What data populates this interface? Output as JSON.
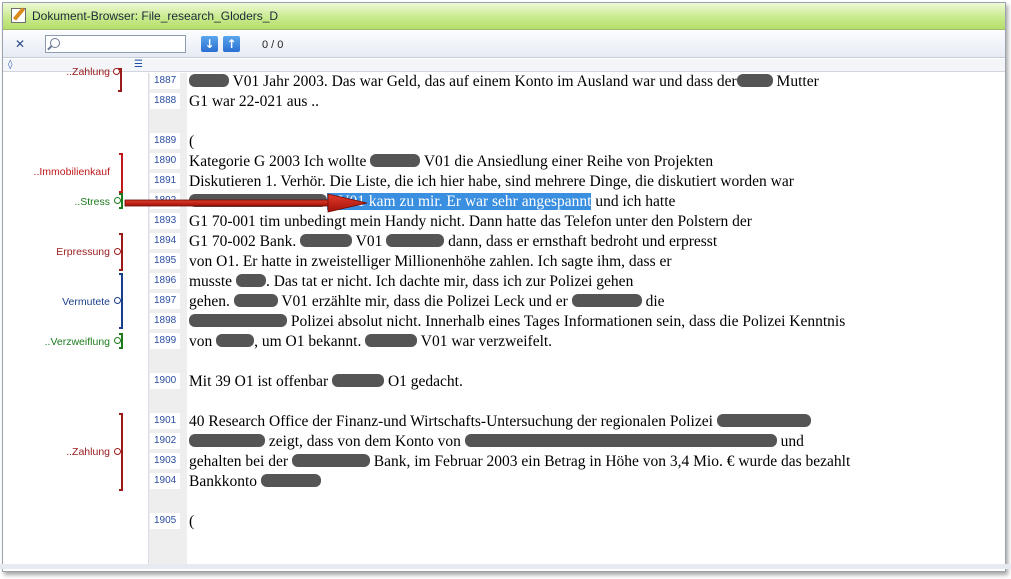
{
  "window": {
    "title": "Dokument-Browser: File_research_Gloders_D"
  },
  "toolbar": {
    "search_placeholder": "",
    "count": "0 / 0"
  },
  "codes": [
    {
      "label": "..Zahlung",
      "color": "#9b1b1b"
    },
    {
      "label": "..Immobilienkauf",
      "color": "#c01818"
    },
    {
      "label": "..Stress",
      "color": "#1d7a1d"
    },
    {
      "label": "Erpressung",
      "color": "#9b1b1b"
    },
    {
      "label": "Vermutete",
      "color": "#1a3f8a"
    },
    {
      "label": "..Verzweiflung",
      "color": "#1d7a1d"
    },
    {
      "label": "..Zahlung",
      "color": "#9b1b1b"
    }
  ],
  "lines": [
    {
      "num": "1887",
      "parts": [
        "",
        " V01 Jahr 2003. Das war Geld, das auf einem Konto im Ausland war und dass der",
        " Mutter"
      ]
    },
    {
      "num": "1888",
      "parts": [
        "G1 war 22-021 aus .."
      ]
    },
    {
      "num": "1889",
      "parts": [
        "("
      ]
    },
    {
      "num": "1890",
      "parts": [
        "Kategorie G 2003 Ich wollte ",
        " V01 die Ansiedlung einer Reihe von Projekten"
      ]
    },
    {
      "num": "1891",
      "parts": [
        "Diskutieren 1. Verhör. Die Liste, die ich hier habe, sind mehrere Dinge, die diskutiert worden war"
      ]
    },
    {
      "num": "1892",
      "parts": [
        "1 V01 kam zu mir. Er war sehr angespannt",
        " und ich hatte"
      ]
    },
    {
      "num": "1893",
      "parts": [
        "G1 70-001 tim unbedingt mein Handy nicht. Dann hatte das Telefon unter den Polstern der"
      ]
    },
    {
      "num": "1894",
      "parts": [
        "G1 70-002 Bank. ",
        " V01 ",
        " dann, dass er ernsthaft bedroht und erpresst"
      ]
    },
    {
      "num": "1895",
      "parts": [
        "von O1. Er hatte in zweistelliger Millionenhöhe zahlen. Ich sagte ihm, dass er"
      ]
    },
    {
      "num": "1896",
      "parts": [
        "musste ",
        ". Das tat er nicht. Ich dachte mir, dass ich zur Polizei gehen"
      ]
    },
    {
      "num": "1897",
      "parts": [
        "gehen. ",
        " V01 erzählte mir, dass die Polizei Leck und er ",
        " die"
      ]
    },
    {
      "num": "1898",
      "parts": [
        "",
        " Polizei absolut nicht. Innerhalb eines Tages Informationen sein, dass die Polizei Kenntnis"
      ]
    },
    {
      "num": "1899",
      "parts": [
        "von ",
        ", um O1 bekannt. ",
        " V01 war verzweifelt."
      ]
    },
    {
      "num": "1900",
      "parts": [
        "Mit 39 O1 ist offenbar ",
        " O1 gedacht."
      ]
    },
    {
      "num": "1901",
      "parts": [
        "40 Research Office der Finanz-und Wirtschafts-Untersuchung der regionalen Polizei "
      ]
    },
    {
      "num": "1902",
      "parts": [
        "",
        " zeigt, dass von dem Konto von ",
        " und"
      ]
    },
    {
      "num": "1903",
      "parts": [
        "gehalten bei der ",
        " Bank, im Februar 2003 ein Betrag in Höhe von 3,4 Mio. € wurde das bezahlt"
      ]
    },
    {
      "num": "1904",
      "parts": [
        "Bankkonto "
      ]
    },
    {
      "num": "1905",
      "parts": [
        "("
      ]
    }
  ]
}
